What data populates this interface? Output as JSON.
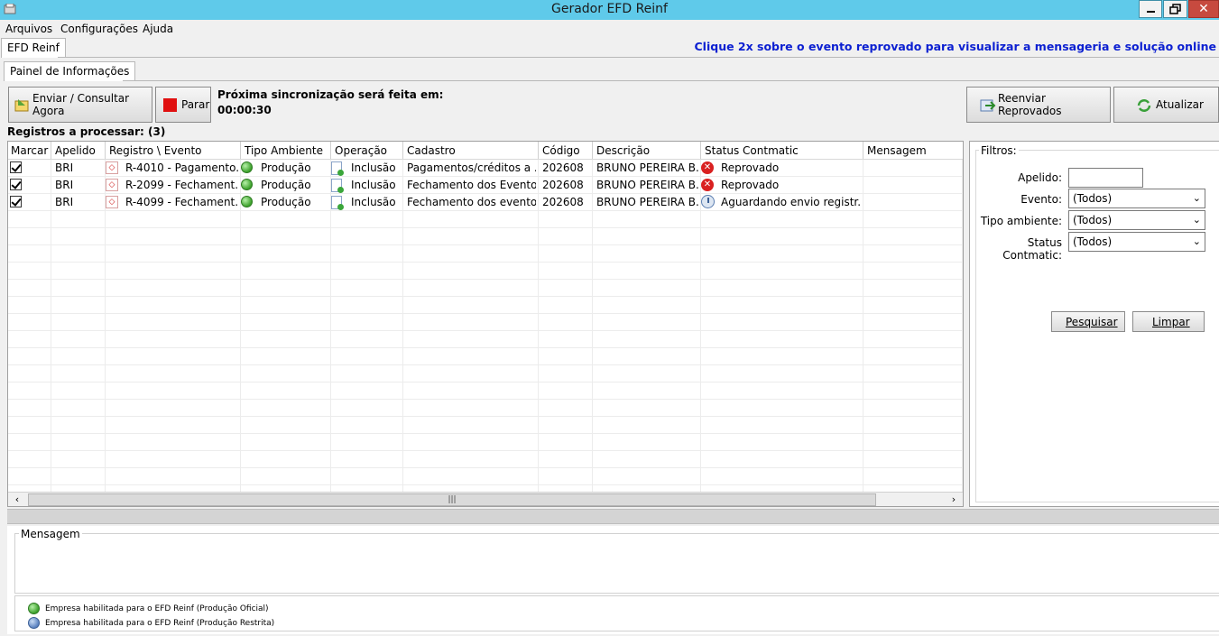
{
  "window": {
    "title": "Gerador EFD Reinf"
  },
  "menu": [
    "Arquivos",
    "Configurações",
    "Ajuda"
  ],
  "top_tab": "EFD Reinf",
  "hint": "Clique 2x sobre o evento reprovado para visualizar a mensageria e solução online",
  "inner_tab": "Painel de Informações",
  "toolbar": {
    "send_label": "Enviar / Consultar Agora",
    "stop_label": "Parar",
    "sync_label": "Próxima sincronização será feita em:",
    "sync_time": "00:00:30",
    "resend_label": "Reenviar Reprovados",
    "refresh_label": "Atualizar"
  },
  "records_label": "Registros a processar: (3)",
  "grid": {
    "columns": [
      "Marcar",
      "Apelido",
      "Registro \\ Evento",
      "Tipo Ambiente",
      "Operação",
      "Cadastro",
      "Código",
      "Descrição",
      "Status Contmatic",
      "Mensagem"
    ],
    "rows": [
      {
        "checked": true,
        "apelido": "BRI",
        "evento": "R-4010 - Pagamento...",
        "ambiente": "Produção",
        "operacao": "Inclusão",
        "cadastro": "Pagamentos/créditos a ...",
        "codigo": "202608",
        "descricao": "BRUNO PEREIRA B...",
        "status": "Reprovado",
        "status_icon": "error-icon",
        "mensagem": ""
      },
      {
        "checked": true,
        "apelido": "BRI",
        "evento": "R-2099 - Fechament...",
        "ambiente": "Produção",
        "operacao": "Inclusão",
        "cadastro": "Fechamento dos Evento...",
        "codigo": "202608",
        "descricao": "BRUNO PEREIRA B...",
        "status": "Reprovado",
        "status_icon": "error-icon",
        "mensagem": ""
      },
      {
        "checked": true,
        "apelido": "BRI",
        "evento": "R-4099 - Fechament...",
        "ambiente": "Produção",
        "operacao": "Inclusão",
        "cadastro": "Fechamento dos evento...",
        "codigo": "202608",
        "descricao": "BRUNO PEREIRA B...",
        "status": "Aguardando envio registr...",
        "status_icon": "clock-icon",
        "mensagem": ""
      }
    ]
  },
  "filters": {
    "title": "Filtros:",
    "apelido_label": "Apelido:",
    "apelido_value": "",
    "evento_label": "Evento:",
    "evento_value": "(Todos)",
    "ambiente_label": "Tipo ambiente:",
    "ambiente_value": "(Todos)",
    "status_label": "Status Contmatic:",
    "status_value": "(Todos)",
    "search_label": "Pesquisar",
    "clear_label": "Limpar"
  },
  "message": {
    "title": "Mensagem"
  },
  "legend": {
    "official": "Empresa habilitada para o EFD Reinf (Produção Oficial)",
    "restricted": "Empresa habilitada para o EFD Reinf (Produção Restrita)"
  },
  "colors": {
    "titlebar": "#5fcaea",
    "hint": "#0b1fd1",
    "green": "#3ba02a",
    "blue": "#5a82c0",
    "error": "#d92020"
  }
}
